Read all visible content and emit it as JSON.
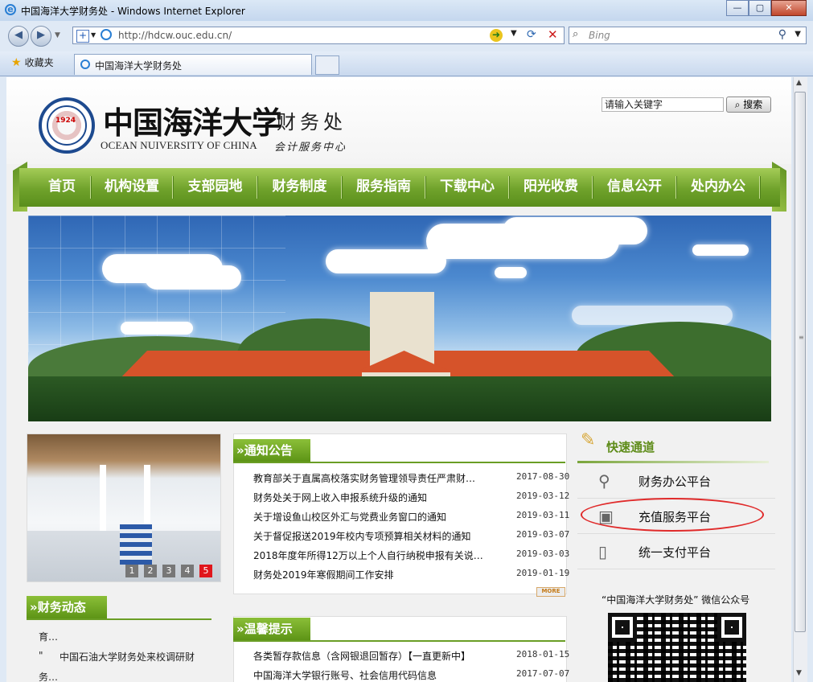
{
  "window": {
    "title": "中国海洋大学财务处 - Windows Internet Explorer"
  },
  "browser": {
    "url": "http://hdcw.ouc.edu.cn/",
    "search_placeholder": "Bing",
    "favorites_label": "收藏夹",
    "tab_title": "中国海洋大学财务处"
  },
  "site": {
    "logo_cn": "中国海洋大学",
    "logo_en": "OCEAN NUIVERSITY OF CHINA",
    "emblem_year": "1924",
    "dept_name": "财务处",
    "dept_sub": "会计服务中心",
    "search_value": "请输入关键字",
    "search_button": "搜索",
    "nav": [
      "首页",
      "机构设置",
      "支部园地",
      "财务制度",
      "服务指南",
      "下载中心",
      "阳光收费",
      "信息公开",
      "处内办公"
    ]
  },
  "slideshow": {
    "pages": [
      "1",
      "2",
      "3",
      "4",
      "5"
    ],
    "active": "5"
  },
  "notices": {
    "title": "通知公告",
    "items": [
      {
        "title": "教育部关于直属高校落实财务管理领导责任严肃财…",
        "date": "2017-08-30"
      },
      {
        "title": "财务处关于网上收入申报系统升级的通知",
        "date": "2019-03-12"
      },
      {
        "title": "关于增设鱼山校区外汇与党费业务窗口的通知",
        "date": "2019-03-11"
      },
      {
        "title": "关于督促报送2019年校内专项预算相关材料的通知",
        "date": "2019-03-07"
      },
      {
        "title": "2018年度年所得12万以上个人自行纳税申报有关说…",
        "date": "2019-03-03"
      },
      {
        "title": "财务处2019年寒假期间工作安排",
        "date": "2019-01-19"
      }
    ],
    "more": "MORE"
  },
  "news": {
    "title": "财务动态",
    "items": [
      "育…",
      "中国石油大学财务处来校调研财",
      "务…"
    ]
  },
  "tips": {
    "title": "温馨提示",
    "items": [
      {
        "title": "各类暂存款信息（含网银退回暂存）【一直更新中】",
        "date": "2018-01-15"
      },
      {
        "title": "中国海洋大学银行账号、社会信用代码信息",
        "date": "2017-07-07"
      }
    ]
  },
  "quick": {
    "title": "快速通道",
    "items": [
      {
        "label": "财务办公平台",
        "icon": "search-icon"
      },
      {
        "label": "充值服务平台",
        "icon": "wallet-icon"
      },
      {
        "label": "统一支付平台",
        "icon": "phone-icon"
      }
    ],
    "wechat_label": "“中国海洋大学财务处” 微信公众号"
  }
}
